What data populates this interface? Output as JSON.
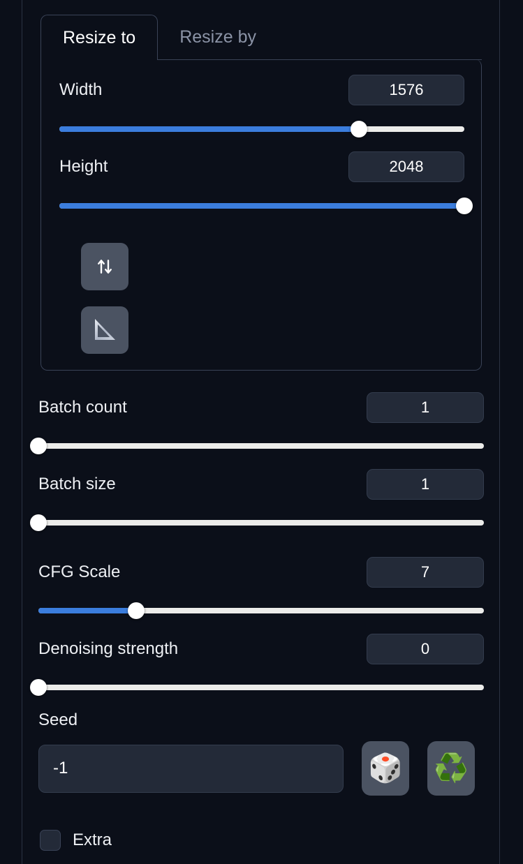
{
  "theme": {
    "page_bg": "#0b0f19",
    "panel_border": "#3a4357",
    "accent_blue": "#3b7ddd",
    "track": "#ececea",
    "input_bg": "#232a38",
    "button_bg": "#4b5362",
    "text": "#eef0f4",
    "muted_text": "#8b93a6"
  },
  "tabs": [
    {
      "label": "Resize to",
      "active": true
    },
    {
      "label": "Resize by",
      "active": false
    }
  ],
  "resize_to": {
    "width": {
      "label": "Width",
      "value": "1576",
      "slider_percent": 74
    },
    "height": {
      "label": "Height",
      "value": "2048",
      "slider_percent": 100
    },
    "buttons": [
      {
        "name": "swap-dimensions-button",
        "icon": "swap-arrows-icon",
        "glyph": "⇅"
      },
      {
        "name": "aspect-ratio-button",
        "icon": "set-square-ruler-icon",
        "glyph": ""
      }
    ]
  },
  "batch_count": {
    "label": "Batch count",
    "value": "1",
    "slider_percent": 0
  },
  "batch_size": {
    "label": "Batch size",
    "value": "1",
    "slider_percent": 0
  },
  "cfg_scale": {
    "label": "CFG Scale",
    "value": "7",
    "slider_percent": 22
  },
  "denoising_strength": {
    "label": "Denoising strength",
    "value": "0",
    "slider_percent": 0
  },
  "seed": {
    "label": "Seed",
    "value": "-1",
    "placeholder": "-1",
    "random_button": {
      "name": "random-seed-button",
      "icon": "dice-icon",
      "glyph": "🎲"
    },
    "recycle_button": {
      "name": "recycle-seed-button",
      "icon": "recycle-icon",
      "glyph": "♻️"
    }
  },
  "extra": {
    "label": "Extra",
    "checked": false
  }
}
